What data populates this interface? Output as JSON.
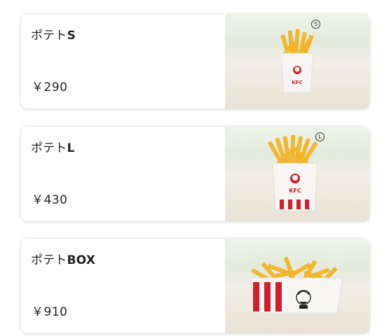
{
  "items": [
    {
      "name_prefix": "ポテト",
      "name_suffix": "S",
      "price": "￥290",
      "size_badge": "S",
      "brand": "KFC"
    },
    {
      "name_prefix": "ポテト",
      "name_suffix": "L",
      "price": "￥430",
      "size_badge": "L",
      "brand": "KFC"
    },
    {
      "name_prefix": "ポテト",
      "name_suffix": "BOX",
      "price": "￥910",
      "size_badge": "",
      "brand": ""
    }
  ],
  "colors": {
    "kfc_red": "#d0202e",
    "fries": "#f4b92a",
    "text": "#222222"
  }
}
